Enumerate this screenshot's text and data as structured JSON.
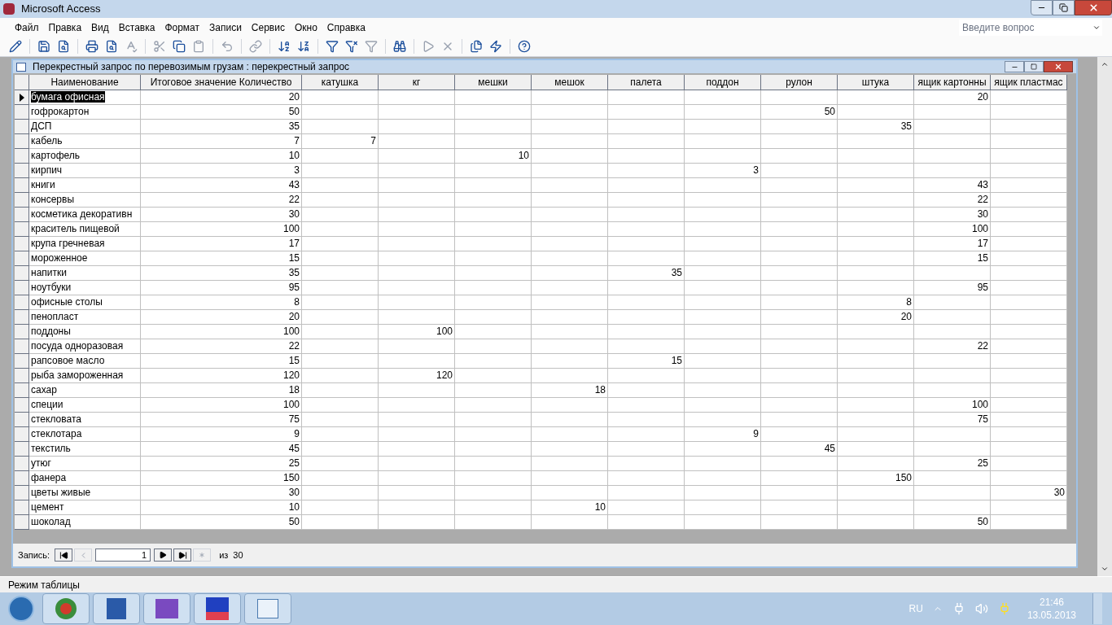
{
  "window": {
    "title": "Microsoft Access"
  },
  "menu": [
    "Файл",
    "Правка",
    "Вид",
    "Вставка",
    "Формат",
    "Записи",
    "Сервис",
    "Окно",
    "Справка"
  ],
  "help_search": {
    "placeholder": "Введите вопрос"
  },
  "document": {
    "title": "Перекрестный запрос по перевозимым грузам : перекрестный запрос"
  },
  "table": {
    "columns": [
      "Наименование",
      "Итоговое значение Количество",
      "катушка",
      "кг",
      "мешки",
      "мешок",
      "палета",
      "поддон",
      "рулон",
      "штука",
      "ящик картонны",
      "ящик пластмас"
    ],
    "rows": [
      {
        "selected": true,
        "cells": [
          "бумага офисная",
          "20",
          null,
          null,
          null,
          null,
          null,
          null,
          null,
          null,
          "20",
          null
        ]
      },
      {
        "selected": false,
        "cells": [
          "гофрокартон",
          "50",
          null,
          null,
          null,
          null,
          null,
          null,
          "50",
          null,
          null,
          null
        ]
      },
      {
        "selected": false,
        "cells": [
          "ДСП",
          "35",
          null,
          null,
          null,
          null,
          null,
          null,
          null,
          "35",
          null,
          null
        ]
      },
      {
        "selected": false,
        "cells": [
          "кабель",
          "7",
          "7",
          null,
          null,
          null,
          null,
          null,
          null,
          null,
          null,
          null
        ]
      },
      {
        "selected": false,
        "cells": [
          "картофель",
          "10",
          null,
          null,
          "10",
          null,
          null,
          null,
          null,
          null,
          null,
          null
        ]
      },
      {
        "selected": false,
        "cells": [
          "кирпич",
          "3",
          null,
          null,
          null,
          null,
          null,
          "3",
          null,
          null,
          null,
          null
        ]
      },
      {
        "selected": false,
        "cells": [
          "книги",
          "43",
          null,
          null,
          null,
          null,
          null,
          null,
          null,
          null,
          "43",
          null
        ]
      },
      {
        "selected": false,
        "cells": [
          "консервы",
          "22",
          null,
          null,
          null,
          null,
          null,
          null,
          null,
          null,
          "22",
          null
        ]
      },
      {
        "selected": false,
        "cells": [
          "косметика декоративн",
          "30",
          null,
          null,
          null,
          null,
          null,
          null,
          null,
          null,
          "30",
          null
        ]
      },
      {
        "selected": false,
        "cells": [
          "краситель пищевой",
          "100",
          null,
          null,
          null,
          null,
          null,
          null,
          null,
          null,
          "100",
          null
        ]
      },
      {
        "selected": false,
        "cells": [
          "крупа гречневая",
          "17",
          null,
          null,
          null,
          null,
          null,
          null,
          null,
          null,
          "17",
          null
        ]
      },
      {
        "selected": false,
        "cells": [
          "мороженное",
          "15",
          null,
          null,
          null,
          null,
          null,
          null,
          null,
          null,
          "15",
          null
        ]
      },
      {
        "selected": false,
        "cells": [
          "напитки",
          "35",
          null,
          null,
          null,
          null,
          "35",
          null,
          null,
          null,
          null,
          null
        ]
      },
      {
        "selected": false,
        "cells": [
          "ноутбуки",
          "95",
          null,
          null,
          null,
          null,
          null,
          null,
          null,
          null,
          "95",
          null
        ]
      },
      {
        "selected": false,
        "cells": [
          "офисные столы",
          "8",
          null,
          null,
          null,
          null,
          null,
          null,
          null,
          "8",
          null,
          null
        ]
      },
      {
        "selected": false,
        "cells": [
          "пенопласт",
          "20",
          null,
          null,
          null,
          null,
          null,
          null,
          null,
          "20",
          null,
          null
        ]
      },
      {
        "selected": false,
        "cells": [
          "поддоны",
          "100",
          null,
          "100",
          null,
          null,
          null,
          null,
          null,
          null,
          null,
          null
        ]
      },
      {
        "selected": false,
        "cells": [
          "посуда одноразовая",
          "22",
          null,
          null,
          null,
          null,
          null,
          null,
          null,
          null,
          "22",
          null
        ]
      },
      {
        "selected": false,
        "cells": [
          "рапсовое масло",
          "15",
          null,
          null,
          null,
          null,
          "15",
          null,
          null,
          null,
          null,
          null
        ]
      },
      {
        "selected": false,
        "cells": [
          "рыба замороженная",
          "120",
          null,
          "120",
          null,
          null,
          null,
          null,
          null,
          null,
          null,
          null
        ]
      },
      {
        "selected": false,
        "cells": [
          "сахар",
          "18",
          null,
          null,
          null,
          "18",
          null,
          null,
          null,
          null,
          null,
          null
        ]
      },
      {
        "selected": false,
        "cells": [
          "специи",
          "100",
          null,
          null,
          null,
          null,
          null,
          null,
          null,
          null,
          "100",
          null
        ]
      },
      {
        "selected": false,
        "cells": [
          "стекловата",
          "75",
          null,
          null,
          null,
          null,
          null,
          null,
          null,
          null,
          "75",
          null
        ]
      },
      {
        "selected": false,
        "cells": [
          "стеклотара",
          "9",
          null,
          null,
          null,
          null,
          null,
          "9",
          null,
          null,
          null,
          null
        ]
      },
      {
        "selected": false,
        "cells": [
          "текстиль",
          "45",
          null,
          null,
          null,
          null,
          null,
          null,
          "45",
          null,
          null,
          null
        ]
      },
      {
        "selected": false,
        "cells": [
          "утюг",
          "25",
          null,
          null,
          null,
          null,
          null,
          null,
          null,
          null,
          "25",
          null
        ]
      },
      {
        "selected": false,
        "cells": [
          "фанера",
          "150",
          null,
          null,
          null,
          null,
          null,
          null,
          null,
          "150",
          null,
          null
        ]
      },
      {
        "selected": false,
        "cells": [
          "цветы живые",
          "30",
          null,
          null,
          null,
          null,
          null,
          null,
          null,
          null,
          null,
          "30"
        ]
      },
      {
        "selected": false,
        "cells": [
          "цемент",
          "10",
          null,
          null,
          null,
          "10",
          null,
          null,
          null,
          null,
          null,
          null
        ]
      },
      {
        "selected": false,
        "cells": [
          "шоколад",
          "50",
          null,
          null,
          null,
          null,
          null,
          null,
          null,
          null,
          "50",
          null
        ]
      }
    ]
  },
  "record_nav": {
    "label": "Запись:",
    "current": "1",
    "of": "из",
    "total": "30"
  },
  "status_bar": "Режим таблицы",
  "taskbar": {
    "language": "RU",
    "time": "21:46",
    "date": "13.05.2013"
  }
}
